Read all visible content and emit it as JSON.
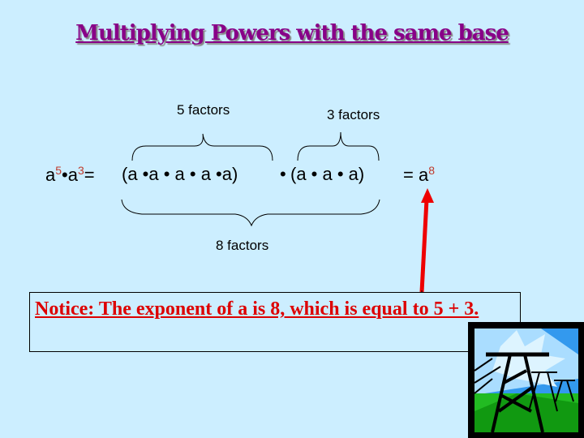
{
  "title": "Multiplying Powers with the same base",
  "labels": {
    "five_factors": "5 factors",
    "three_factors": "3 factors",
    "eight_factors": "8 factors"
  },
  "equation": {
    "base": "a",
    "exp1": "5",
    "dot": "•",
    "exp2": "3",
    "equals": "=",
    "group1": "(a •a • a • a •a)",
    "joiner": "•",
    "group2": "(a • a • a)",
    "result_prefix": "= a",
    "result_exp": "8"
  },
  "notice": "Notice:  The exponent of a is 8, which is equal to 5 + 3.",
  "colors": {
    "background": "#cceeff",
    "title": "#880088",
    "notice": "#dd0000",
    "arrow": "#ee0000",
    "exponent": "#c0392b"
  },
  "image": {
    "icon": "power-lines-clipart-icon"
  }
}
